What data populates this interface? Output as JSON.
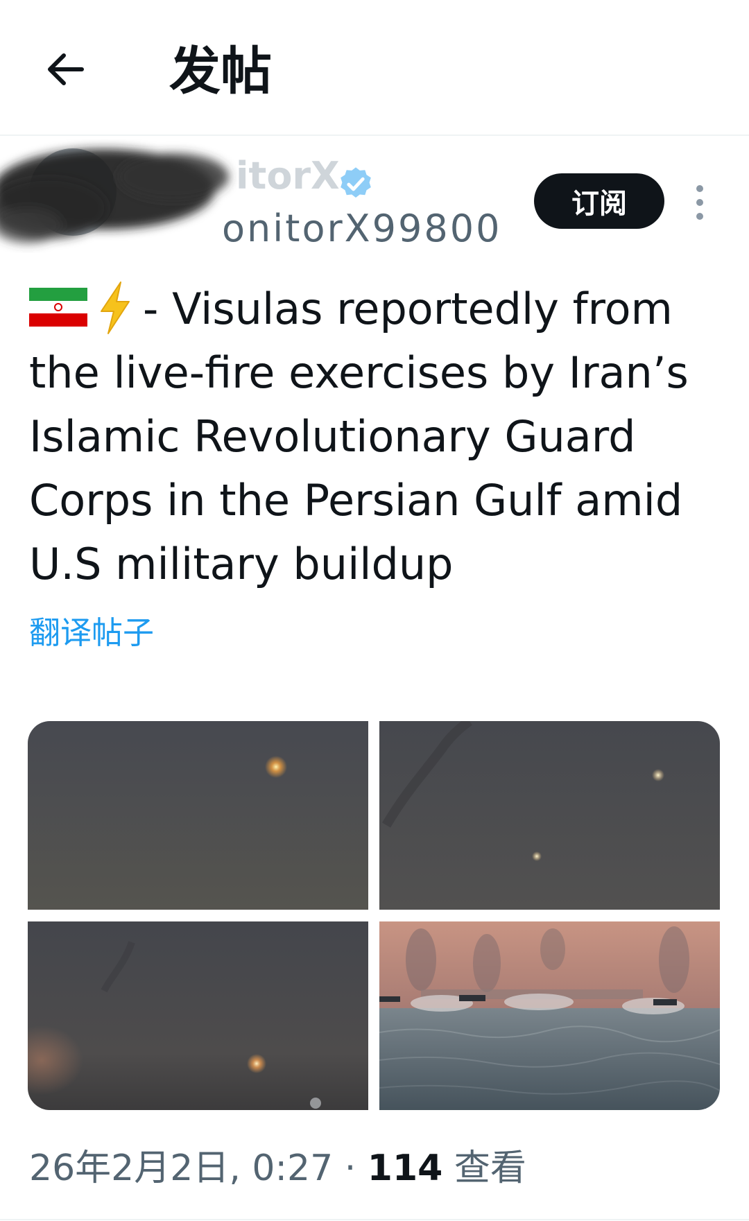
{
  "header": {
    "title": "发帖",
    "back_icon": "arrow-left-icon"
  },
  "author": {
    "name": "itorX",
    "handle": "onitorX99800",
    "verified_icon": "verified-badge-icon",
    "subscribe_label": "订阅",
    "more_icon": "more-vertical-icon"
  },
  "post": {
    "text": "- Visulas reportedly from the live-fire exercises by Iran’s Islamic Revolutionary Guard Corps in the Persian Gulf amid U.S military buildup",
    "emoji": [
      "iran-flag-icon",
      "lightning-icon"
    ],
    "translate_label": "翻译帖子"
  },
  "media": {
    "count": 4,
    "colors": {
      "dusk_sky": "#4c4e53",
      "orange_sky": "#b98a7e",
      "sea": "#4d5c66"
    }
  },
  "meta": {
    "timestamp": "26年2月2日, 0:27",
    "separator": "·",
    "views_count": "114",
    "views_label": "查看"
  },
  "colors": {
    "accent": "#1d9bf0",
    "text": "#0f1419",
    "secondary": "#536471"
  }
}
